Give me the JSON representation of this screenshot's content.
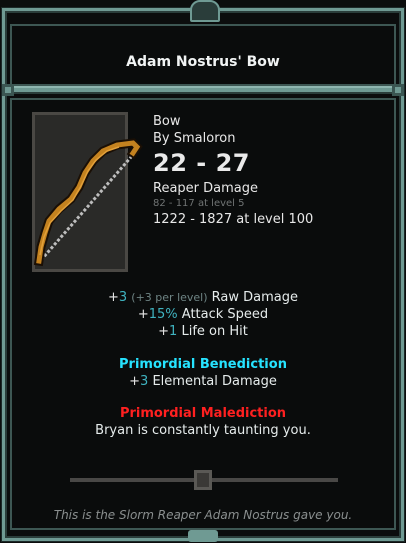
{
  "item": {
    "name": "Adam Nostrus' Bow",
    "type": "Bow",
    "author": "By Smaloron",
    "damage_range": "22 - 27",
    "damage_type": "Reaper Damage",
    "level_range_note": "82 - 117 at level 5",
    "level_100_range": "1222 - 1827 at level 100",
    "icon": "bow-icon"
  },
  "stats": [
    {
      "plus": "+",
      "value": "3",
      "hint": "(+3 per level)",
      "label": "Raw Damage"
    },
    {
      "plus": "+",
      "value": "15%",
      "hint": "",
      "label": "Attack Speed"
    },
    {
      "plus": "+",
      "value": "1",
      "hint": "",
      "label": "Life on Hit"
    }
  ],
  "benediction": {
    "title": "Primordial Benediction",
    "plus": "+",
    "value": "3",
    "label": "Elemental Damage"
  },
  "malediction": {
    "title": "Primordial Malediction",
    "text": "Bryan is constantly taunting you."
  },
  "flavor_text": "This is the Slorm Reaper Adam Nostrus gave you.",
  "colors": {
    "frame": "#6f9a93",
    "benediction": "#26e3ff",
    "malediction": "#ff2020",
    "stat_value": "#3fb3c0"
  }
}
